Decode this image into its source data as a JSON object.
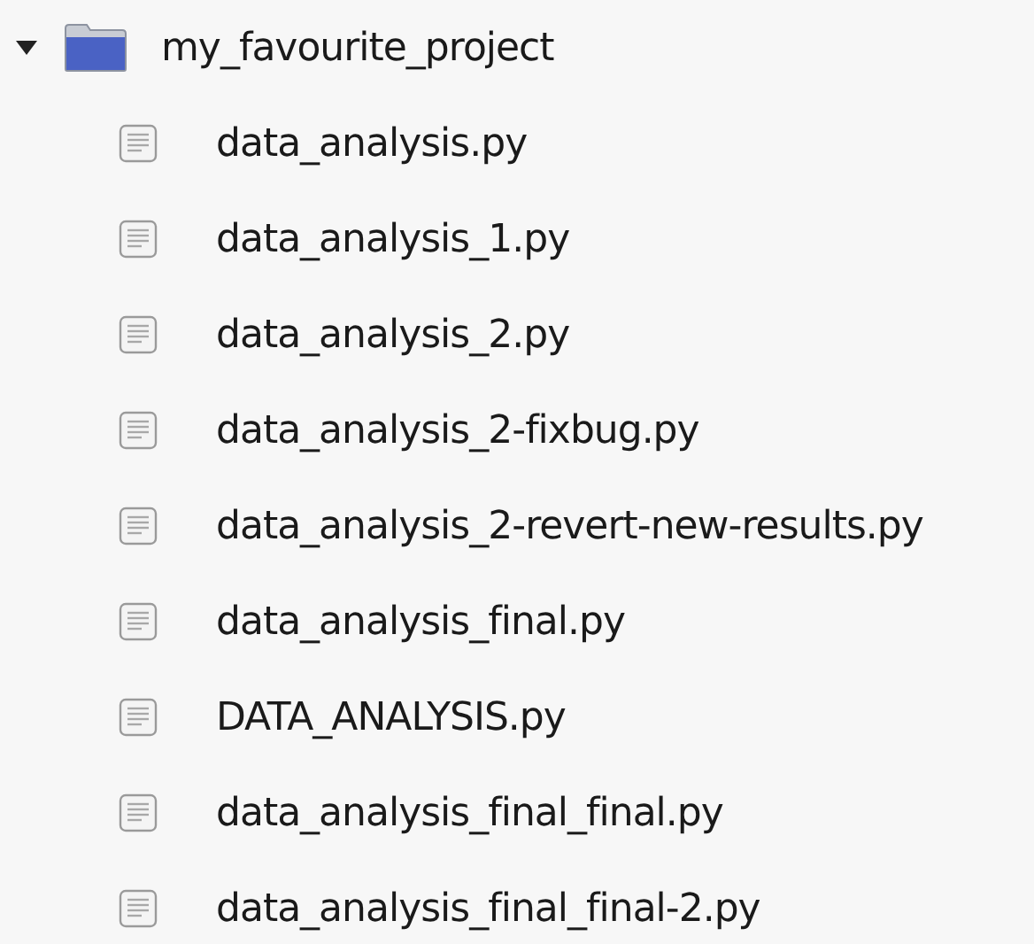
{
  "tree": {
    "label": "my_favourite_project",
    "expanded": true,
    "children": [
      {
        "label": "data_analysis.py"
      },
      {
        "label": "data_analysis_1.py"
      },
      {
        "label": "data_analysis_2.py"
      },
      {
        "label": "data_analysis_2-fixbug.py"
      },
      {
        "label": "data_analysis_2-revert-new-results.py"
      },
      {
        "label": "data_analysis_final.py"
      },
      {
        "label": "DATA_ANALYSIS.py"
      },
      {
        "label": "data_analysis_final_final.py"
      },
      {
        "label": "data_analysis_final_final-2.py"
      }
    ]
  }
}
